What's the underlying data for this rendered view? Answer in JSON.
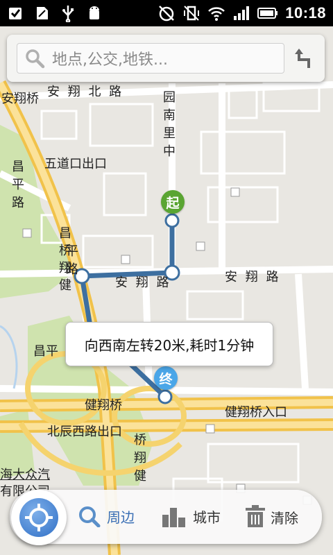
{
  "status_bar": {
    "time": "10:18",
    "left_icons": [
      "checkbox-icon",
      "sd-card-icon",
      "usb-icon",
      "android-debug-icon"
    ],
    "right_icons": [
      "alarm-off-icon",
      "vibrate-off-icon",
      "wifi-icon",
      "signal-icon",
      "battery-icon"
    ]
  },
  "search": {
    "placeholder": "地点,公交,地铁..."
  },
  "map": {
    "road_labels": {
      "anxiang_north": "安 翔 北 路",
      "anxiang_bridge": "安翔桥",
      "wudaokou_exit": "五道口出口",
      "anxiang_road_left": "安 翔 路",
      "anxiang_road_right": "安 翔 路",
      "jianxiang_bridge": "健翔桥",
      "jianxiang_entry": "健翔桥入口",
      "beichen_exit": "北辰西路出口",
      "changping_partial": "昌平",
      "auto_partial": "海大众汽",
      "company_partial": "有限公司"
    },
    "vertical_labels": {
      "yuannan": "园南里中",
      "changping": "昌平路",
      "changping_bridge": "昌桥翔健",
      "ping_road": "平路",
      "qiaoxiang": "桥翔健"
    },
    "route_tooltip": "向西南左转20米,耗时1分钟",
    "start_marker": "起",
    "end_marker": "终",
    "colors": {
      "route": "#3d6fa0",
      "start": "#5aa532",
      "end": "#4aa6e8",
      "highway": "#f7cc5a",
      "green_area": "#cfe3ae"
    }
  },
  "bottom_bar": {
    "nearby_label": "周边",
    "city_label": "城市",
    "clear_label": "清除"
  }
}
